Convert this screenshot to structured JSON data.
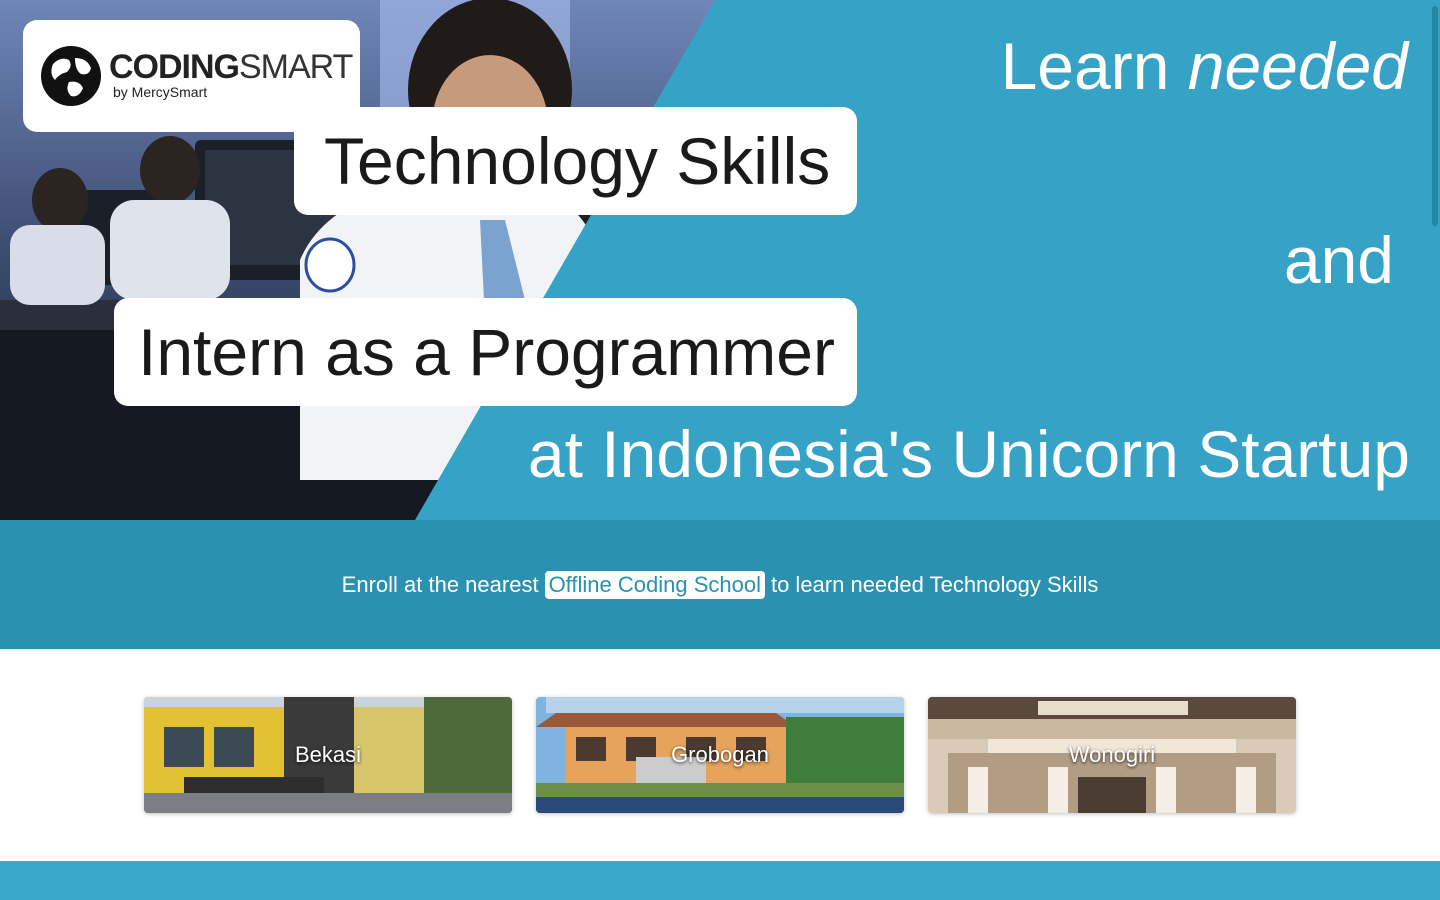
{
  "logo": {
    "word_bold": "CODING",
    "word_light": "SMART",
    "subtitle": "by MercySmart",
    "icon": "globe-icon"
  },
  "hero": {
    "line1_plain": "Learn",
    "line1_italic": "needed",
    "pill1": "Technology Skills",
    "and": "and",
    "pill2": "Intern as a Programmer",
    "last": "at Indonesia's Unicorn Startup"
  },
  "enroll": {
    "before": "Enroll at the nearest",
    "link": "Offline Coding School",
    "after": "to learn needed Technology Skills"
  },
  "schools": [
    {
      "name": "Bekasi"
    },
    {
      "name": "Grobogan"
    },
    {
      "name": "Wonogiri"
    }
  ],
  "colors": {
    "primary": "#35a2c6",
    "band": "#2a91b1"
  }
}
